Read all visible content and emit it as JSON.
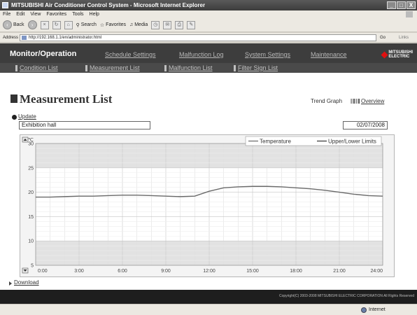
{
  "window": {
    "title": "MITSUBISHI Air Conditioner Control System - Microsoft Internet Explorer",
    "controls": [
      "_",
      "□",
      "X"
    ]
  },
  "browser": {
    "menu": [
      "File",
      "Edit",
      "View",
      "Favorites",
      "Tools",
      "Help"
    ],
    "toolbar": {
      "back_label": "Back",
      "search_label": "Search",
      "favorites_label": "Favorites",
      "media_label": "Media"
    },
    "address_label": "Address",
    "address_value": "http://192.168.1.1/en/administrator.html",
    "go_label": "Go",
    "links_label": "Links",
    "status_left": "",
    "status_zone": "Internet"
  },
  "app": {
    "title": "Monitor/Operation",
    "nav": [
      "Schedule Settings",
      "Malfunction Log",
      "System Settings",
      "Maintenance"
    ],
    "subnav": [
      "Condition List",
      "Measurement List",
      "Malfunction List",
      "Filter Sign List"
    ],
    "logo_text_1": "MITSUBISHI",
    "logo_text_2": "ELECTRIC",
    "copyright": "Copyright(C) 2003-2008 MITSUBISHI ELECTRIC CORPORATION All Rights Reserved"
  },
  "page": {
    "title": "Measurement List",
    "trend_graph_label": "Trend Graph",
    "overview_link": "Overview",
    "update_link": "Update",
    "group_name": "Exhibition hall",
    "date": "02/07/2008",
    "download_link": "Download",
    "scroll_up_icon": "scroll-up-icon",
    "scroll_down_icon": "scroll-down-icon"
  },
  "chart_data": {
    "type": "line",
    "ylabel": "℃",
    "ylim": [
      5,
      30
    ],
    "yticks": [
      5,
      10,
      15,
      20,
      25,
      30
    ],
    "xticks": [
      "0:00",
      "3:00",
      "6:00",
      "9:00",
      "12:00",
      "15:00",
      "18:00",
      "21:00",
      "24:00"
    ],
    "xlim": [
      0,
      24
    ],
    "grid": true,
    "legend_position": "top-right",
    "bands": [
      {
        "from": 5,
        "to": 10,
        "color": "#e2e2e2"
      },
      {
        "from": 25,
        "to": 30,
        "color": "#e2e2e2"
      }
    ],
    "series": [
      {
        "name": "Temperature",
        "color": "#6a6a6a",
        "x": [
          0,
          1,
          2,
          3,
          4,
          5,
          6,
          7,
          8,
          9,
          10,
          11,
          12,
          13,
          14,
          15,
          16,
          17,
          18,
          19,
          20,
          21,
          22,
          23,
          24
        ],
        "y": [
          19.0,
          19.0,
          19.1,
          19.2,
          19.2,
          19.3,
          19.4,
          19.4,
          19.3,
          19.2,
          19.1,
          19.2,
          20.2,
          20.9,
          21.1,
          21.2,
          21.2,
          21.1,
          20.9,
          20.7,
          20.4,
          20.0,
          19.6,
          19.3,
          19.2
        ]
      },
      {
        "name": "Upper/Lower Limits",
        "color": "#333333",
        "x": [],
        "y": []
      }
    ]
  }
}
